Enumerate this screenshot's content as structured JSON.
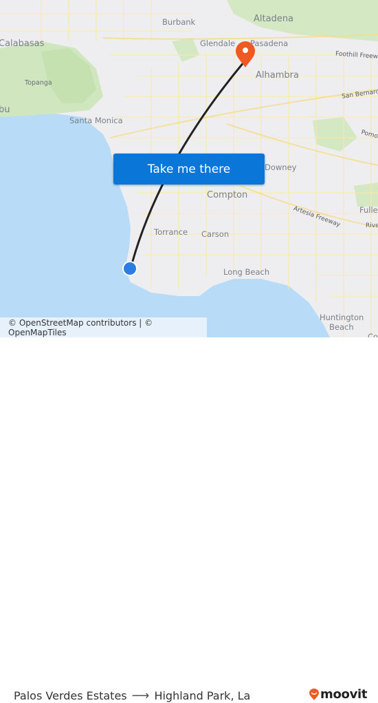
{
  "map": {
    "places": [
      {
        "name": "Burbank",
        "size": "mid"
      },
      {
        "name": "Altadena",
        "size": "big"
      },
      {
        "name": "Glendale",
        "size": "mid"
      },
      {
        "name": "Pasadena",
        "size": "mid"
      },
      {
        "name": "Calabasas",
        "size": "big"
      },
      {
        "name": "Alhambra",
        "size": "big"
      },
      {
        "name": "Topanga",
        "size": "small"
      },
      {
        "name": "bu",
        "size": "big"
      },
      {
        "name": "Santa Monica",
        "size": "mid"
      },
      {
        "name": "Downey",
        "size": "mid"
      },
      {
        "name": "Compton",
        "size": "big"
      },
      {
        "name": "Torrance",
        "size": "mid"
      },
      {
        "name": "Carson",
        "size": "mid"
      },
      {
        "name": "Long Beach",
        "size": "mid"
      },
      {
        "name": "Huntington",
        "size": "mid"
      },
      {
        "name": "Beach",
        "size": "mid"
      },
      {
        "name": "Fuller",
        "size": "mid"
      },
      {
        "name": "Co",
        "size": "mid"
      }
    ],
    "roads": [
      {
        "name": "Foothill Freeway"
      },
      {
        "name": "San Bernardino"
      },
      {
        "name": "Pomona"
      },
      {
        "name": "Artesia Freeway"
      },
      {
        "name": "Rive"
      }
    ],
    "origin_marker": {
      "label": "Palos Verdes Estates",
      "color": "#2a7de1"
    },
    "destination_marker": {
      "label": "Highland Park, La",
      "color": "#f05a22"
    },
    "route_line_color": "#222222"
  },
  "cta": {
    "label": "Take me there"
  },
  "attribution": {
    "text": "© OpenStreetMap contributors | © OpenMapTiles"
  },
  "footer": {
    "origin": "Palos Verdes Estates",
    "arrow": "⟶",
    "destination": "Highland Park, La",
    "brand": "moovit",
    "brand_color": "#f05a22"
  }
}
